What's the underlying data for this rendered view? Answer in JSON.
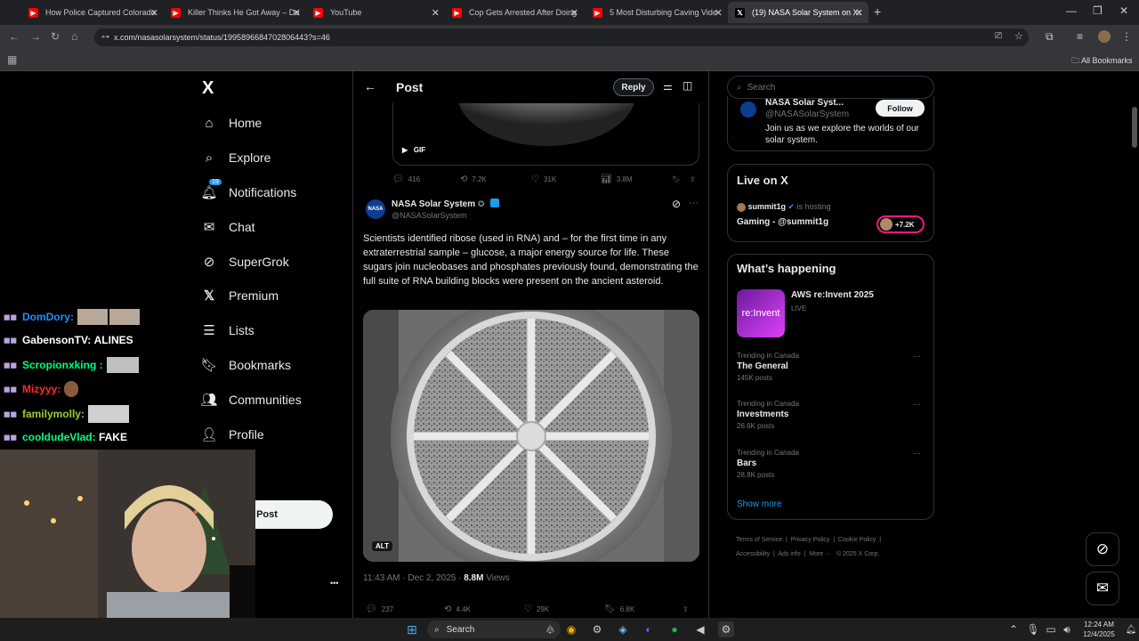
{
  "browser": {
    "tabs": [
      {
        "title": "How Police Captured Colorado",
        "favicon_color": "#ff0000"
      },
      {
        "title": "Killer Thinks He Got Away – Do",
        "favicon_color": "#ff0000"
      },
      {
        "title": "YouTube",
        "favicon_color": "#ff0000"
      },
      {
        "title": "Cop Gets Arrested After Doing",
        "favicon_color": "#ff0000"
      },
      {
        "title": "5 Most Disturbing Caving Vide",
        "favicon_color": "#ff0000"
      },
      {
        "title": "(19) NASA Solar System on X:",
        "favicon_color": "#000000"
      }
    ],
    "new_tab_symbol": "+",
    "url": "x.com/nasasolarsystem/status/1995896684702806443?s=46",
    "all_bookmarks": "All Bookmarks"
  },
  "sidebar": {
    "logo": "X",
    "notifications_badge": "19",
    "items": [
      {
        "label": "Home",
        "icon": "home-icon"
      },
      {
        "label": "Explore",
        "icon": "search-icon"
      },
      {
        "label": "Notifications",
        "icon": "bell-icon"
      },
      {
        "label": "Chat",
        "icon": "mail-icon"
      },
      {
        "label": "SuperGrok",
        "icon": "grok-icon"
      },
      {
        "label": "Premium",
        "icon": "x-icon"
      },
      {
        "label": "Lists",
        "icon": "list-icon"
      },
      {
        "label": "Bookmarks",
        "icon": "bookmark-icon"
      },
      {
        "label": "Communities",
        "icon": "people-icon"
      },
      {
        "label": "Profile",
        "icon": "person-icon"
      }
    ],
    "post_button": "Post",
    "more_symbol": "•••"
  },
  "header": {
    "title": "Post",
    "reply_label": "Reply"
  },
  "previous_tweet": {
    "gif_label": "GIF",
    "replies": "416",
    "reposts": "7.2K",
    "likes": "31K",
    "views": "3.8M"
  },
  "tweet": {
    "author_name": "NASA Solar System",
    "handle": "@NASASolarSystem",
    "text": "Scientists identified ribose (used in RNA) and – for the first time in any extraterrestrial sample – glucose, a major energy source for life. These sugars join nucleobases and phosphates previously found, demonstrating the full suite of RNA building blocks were present on the ancient asteroid.",
    "alt_label": "ALT",
    "timestamp": "11:43 AM · Dec 2, 2025 ·",
    "views_count": "8.8M",
    "views_label": "Views",
    "replies": "237",
    "reposts": "4.4K",
    "likes": "29K",
    "bookmarks": "6.8K"
  },
  "right": {
    "search_placeholder": "Search",
    "profile_name": "NASA Solar Syst...",
    "profile_handle": "@NASASolarSystem",
    "follow_label": "Follow",
    "profile_bio": "Join us as we explore the worlds of our solar system.",
    "live_title": "Live on X",
    "live_host": "summit1g",
    "live_hosting": "is hosting",
    "live_stream_title": "Gaming - @summit1g",
    "live_count": "+7.2K",
    "happening_title": "What’s happening",
    "event_title": "AWS re:Invent 2025",
    "event_status": "LIVE",
    "event_image_text": "re:Invent",
    "trends": [
      {
        "meta": "Trending in Canada",
        "name": "The General",
        "posts": "145K posts"
      },
      {
        "meta": "Trending in Canada",
        "name": "Investments",
        "posts": "26.6K posts"
      },
      {
        "meta": "Trending in Canada",
        "name": "Bars",
        "posts": "28.8K posts"
      }
    ],
    "show_more": "Show more",
    "footer_links": [
      "Terms of Service",
      "Privacy Policy",
      "Cookie Policy",
      "Accessibility",
      "Ads info",
      "More ···",
      "© 2025 X Corp."
    ]
  },
  "stream_chat": [
    {
      "user": "DomDory:",
      "message": "",
      "color": "#1e90ff"
    },
    {
      "user": "GabensonTV:",
      "message": "ALINES",
      "color": "#ffffff"
    },
    {
      "user": "Scropionxking :",
      "message": "",
      "color": "#00ff7f"
    },
    {
      "user": "Mizyyy:",
      "message": "",
      "color": "#ff2a2a"
    },
    {
      "user": "familymolly:",
      "message": "",
      "color": "#9acd32"
    },
    {
      "user": "cooldudeVlad:",
      "message": "FAKE",
      "color": "#00ff7f"
    }
  ],
  "taskbar": {
    "search_label": "Search",
    "time": "12:24 AM",
    "date": "12/4/2025"
  },
  "colors": {
    "x_blue": "#1d9bf0",
    "x_border": "#2f3336",
    "x_muted": "#71767b"
  }
}
